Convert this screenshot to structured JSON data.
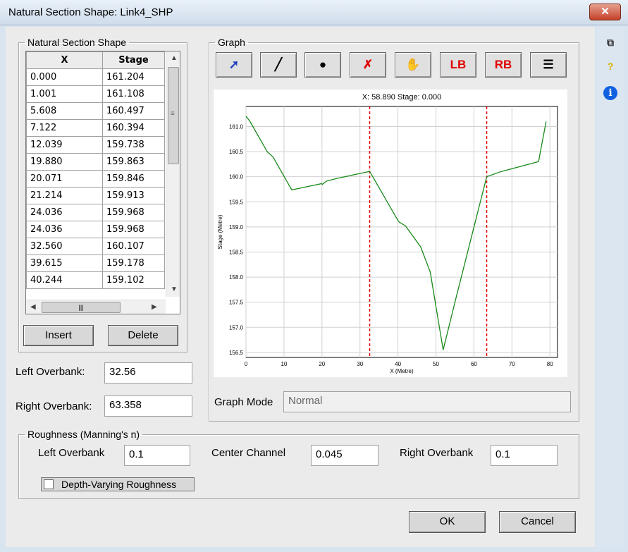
{
  "window": {
    "title": "Natural Section Shape: Link4_SHP",
    "close_label": "✕"
  },
  "shape_panel": {
    "legend": "Natural Section Shape",
    "columns": [
      "X",
      "Stage"
    ],
    "rows": [
      [
        "0.000",
        "161.204"
      ],
      [
        "1.001",
        "161.108"
      ],
      [
        "5.608",
        "160.497"
      ],
      [
        "7.122",
        "160.394"
      ],
      [
        "12.039",
        "159.738"
      ],
      [
        "19.880",
        "159.863"
      ],
      [
        "20.071",
        "159.846"
      ],
      [
        "21.214",
        "159.913"
      ],
      [
        "24.036",
        "159.968"
      ],
      [
        "24.036",
        "159.968"
      ],
      [
        "32.560",
        "160.107"
      ],
      [
        "39.615",
        "159.178"
      ],
      [
        "40.244",
        "159.102"
      ]
    ],
    "insert_label": "Insert",
    "delete_label": "Delete"
  },
  "overbank": {
    "left_label": "Left Overbank:",
    "left_value": "32.56",
    "right_label": "Right Overbank:",
    "right_value": "63.358"
  },
  "graph": {
    "legend": "Graph",
    "tools": [
      {
        "name": "select-tool",
        "glyph": "➚",
        "color": "#2040c0"
      },
      {
        "name": "draw-line-tool",
        "glyph": "╱",
        "color": "#000000"
      },
      {
        "name": "add-point-tool",
        "glyph": "●",
        "color": "#000000"
      },
      {
        "name": "delete-point-tool",
        "glyph": "✗",
        "color": "#e00000"
      },
      {
        "name": "pan-tool",
        "glyph": "✋",
        "color": "#000000"
      },
      {
        "name": "left-bank-tool",
        "glyph": "LB",
        "color": "#e00000"
      },
      {
        "name": "right-bank-tool",
        "glyph": "RB",
        "color": "#e00000"
      },
      {
        "name": "list-tool",
        "glyph": "☰",
        "color": "#000000"
      }
    ],
    "readout": "X: 58.890 Stage: 0.000",
    "mode_label": "Graph Mode",
    "mode_value": "Normal"
  },
  "chart_data": {
    "type": "line",
    "xlabel": "X (Metre)",
    "ylabel": "Stage (Metre)",
    "xlim": [
      0,
      82
    ],
    "ylim": [
      156.4,
      161.4
    ],
    "xticks": [
      0,
      10,
      20,
      30,
      40,
      50,
      60,
      70,
      80
    ],
    "yticks": [
      156.5,
      157.0,
      157.5,
      158.0,
      158.5,
      159.0,
      159.5,
      160.0,
      160.5,
      161.0
    ],
    "ytick_labels": [
      "156.5",
      "157.0",
      "157.5",
      "158.0",
      "158.5",
      "159.0",
      "159.5",
      "160.0",
      "160.5",
      "161.0"
    ],
    "grid": true,
    "series": [
      {
        "x": [
          0.0,
          1.001,
          5.608,
          7.122,
          12.039,
          19.88,
          20.071,
          21.214,
          24.036,
          32.56,
          39.615,
          40.244,
          42.0,
          46.0,
          48.5,
          51.9,
          55.0,
          63.358,
          67.0,
          77.0,
          79.0
        ],
        "y": [
          161.204,
          161.108,
          160.497,
          160.394,
          159.738,
          159.863,
          159.846,
          159.913,
          159.968,
          160.107,
          159.178,
          159.102,
          159.02,
          158.6,
          158.1,
          156.55,
          157.5,
          160.0,
          160.1,
          160.3,
          161.1
        ],
        "color": "#1a8a1a"
      }
    ],
    "bank_lines": [
      32.56,
      63.358
    ],
    "bank_color": "#e00000"
  },
  "roughness": {
    "legend": "Roughness (Manning's n)",
    "left_label": "Left Overbank",
    "left_value": "0.1",
    "center_label": "Center Channel",
    "center_value": "0.045",
    "right_label": "Right Overbank",
    "right_value": "0.1",
    "depth_varying_label": "Depth-Varying Roughness"
  },
  "buttons": {
    "ok": "OK",
    "cancel": "Cancel"
  },
  "side_icons": [
    {
      "name": "copy-icon",
      "glyph": "⧉",
      "color": "#333333"
    },
    {
      "name": "help-icon",
      "glyph": "?",
      "color": "#d8b000"
    },
    {
      "name": "info-icon",
      "glyph": "i",
      "color": "#1060e0"
    }
  ]
}
